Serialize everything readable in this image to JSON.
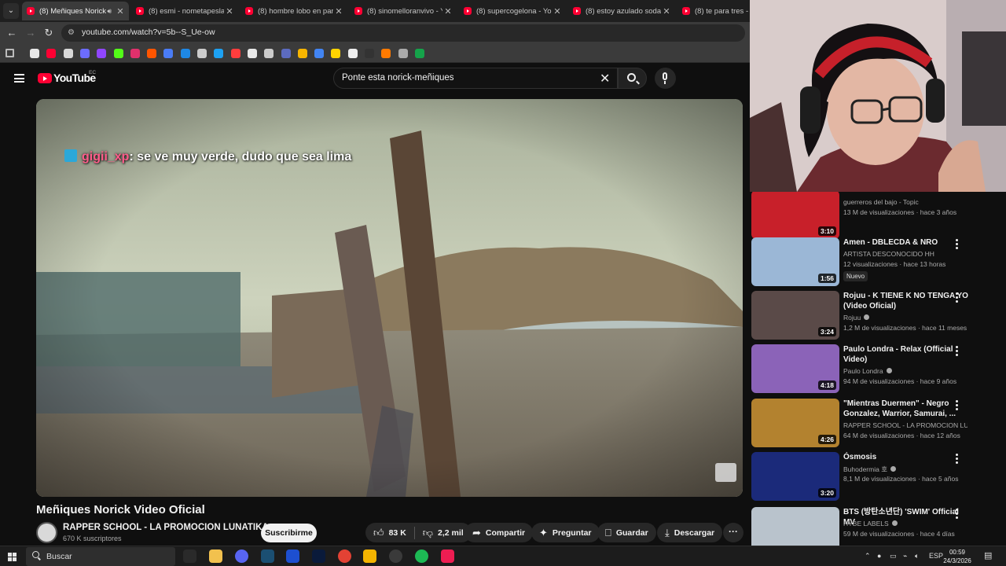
{
  "browser": {
    "tabs": [
      {
        "title": "(8) Meñiques Norick V",
        "active": true,
        "audio": true
      },
      {
        "title": "(8) esmi - nometapeslacara"
      },
      {
        "title": "(8) hombre lobo en paris"
      },
      {
        "title": "(8) sinomelloranvivo - You"
      },
      {
        "title": "(8) supercogelona - YouTu"
      },
      {
        "title": "(8) estoy azulado soda ste"
      },
      {
        "title": "(8) te para tres - YouT"
      }
    ],
    "url": "youtube.com/watch?v=5b--S_Ue-ow"
  },
  "youtube": {
    "logo_text": "YouTube",
    "country_code": "EC",
    "search_query": "Ponte esta norick-meñiques"
  },
  "chat_overlay": {
    "username": "gigii_xp",
    "message": ": se ve muy verde, dudo que sea lima"
  },
  "video": {
    "title": "Meñiques Norick Video Oficial",
    "channel": "RAPPER SCHOOL - LA PROMOCION LUNATIKA",
    "subscribers": "670 K suscriptores",
    "subscribe_label": "Suscribirme",
    "likes": "83 K",
    "dislikes": "2,2 mil",
    "share_label": "Compartir",
    "ask_label": "Preguntar",
    "save_label": "Guardar",
    "download_label": "Descargar"
  },
  "recommendations": [
    {
      "title": "",
      "channel": "guerreros del bajo - Topic",
      "meta": "13 M de visualizaciones · hace 3 años",
      "duration": "3:10",
      "thumb_color": "#c8202a"
    },
    {
      "title": "Amen - DBLECDA & NRO",
      "channel": "ARTISTA DESCONOCIDO HH",
      "meta": "12 visualizaciones · hace 13 horas",
      "duration": "1:56",
      "badge": "Nuevo",
      "thumb_color": "#9bb7d6"
    },
    {
      "title": "Rojuu - K TIENE K NO TENGA YO (Video Oficial)",
      "channel": "Rojuu",
      "verified": true,
      "meta": "1,2 M de visualizaciones · hace 11 meses",
      "duration": "3:24",
      "thumb_color": "#5a4a48"
    },
    {
      "title": "Paulo Londra - Relax (Official Video)",
      "channel": "Paulo Londra",
      "verified": true,
      "meta": "94 M de visualizaciones · hace 9 años",
      "duration": "4:18",
      "thumb_color": "#8b63b8"
    },
    {
      "title": "\"Mientras Duermen\" - Negro Gonzalez, Warrior, Samurai, ...",
      "channel": "RAPPER SCHOOL - LA PROMOCION LUN...",
      "meta": "64 M de visualizaciones · hace 12 años",
      "duration": "4:26",
      "thumb_color": "#b3822f"
    },
    {
      "title": "Ósmosis",
      "channel": "Buhodermia 호",
      "verified": true,
      "meta": "8,1 M de visualizaciones · hace 5 años",
      "duration": "3:20",
      "thumb_color": "#1b2a7a"
    },
    {
      "title": "BTS (방탄소년단) 'SWIM' Official MV",
      "channel": "HYBE LABELS",
      "verified": true,
      "meta": "59 M de visualizaciones · hace 4 días",
      "duration": "",
      "thumb_color": "#b9c3cc"
    }
  ],
  "taskbar": {
    "search_label": "Buscar",
    "language": "ESP",
    "time": "00:59",
    "date": "24/3/2026"
  }
}
